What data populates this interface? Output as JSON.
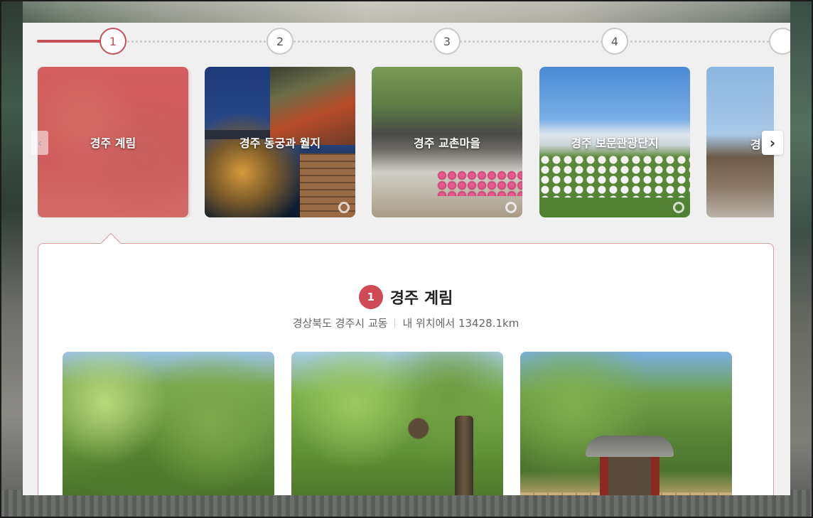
{
  "steps": [
    {
      "label": "1",
      "active": true
    },
    {
      "label": "2",
      "active": false
    },
    {
      "label": "3",
      "active": false
    },
    {
      "label": "4",
      "active": false
    }
  ],
  "cards": [
    {
      "title": "경주 계림"
    },
    {
      "title": "경주 동궁과 월지"
    },
    {
      "title": "경주 교촌마을"
    },
    {
      "title": "경주 보문관광단지"
    },
    {
      "title": "경"
    }
  ],
  "nav": {
    "prev_icon": "‹",
    "next_icon": "›",
    "prev_icon_name": "chevron-left-icon",
    "next_icon_name": "chevron-right-icon"
  },
  "detail": {
    "number": "1",
    "name": "경주 계림",
    "address": "경상북도 경주시 교동",
    "distance": "내 위치에서 13428.1km"
  },
  "colors": {
    "accent": "#c85058",
    "badge": "#cf4a55",
    "panel_bg": "#f1f0f0"
  }
}
